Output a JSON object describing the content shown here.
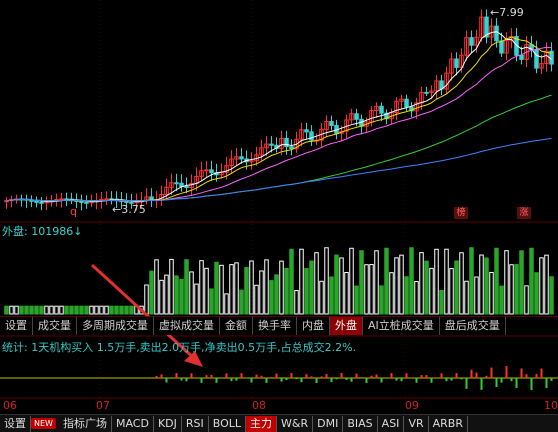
{
  "price_chart": {
    "high_marker": "7.99",
    "low_marker": "3.75",
    "q_marker": "q",
    "badges": [
      "榜",
      "涨"
    ]
  },
  "volume": {
    "title": "外盘: 101986",
    "arrow": "↓"
  },
  "tabs": [
    {
      "label": "设置",
      "active": false
    },
    {
      "label": "成交量",
      "active": false
    },
    {
      "label": "多周期成交量",
      "active": false
    },
    {
      "label": "虚拟成交量",
      "active": false
    },
    {
      "label": "金额",
      "active": false
    },
    {
      "label": "换手率",
      "active": false
    },
    {
      "label": "内盘",
      "active": false
    },
    {
      "label": "外盘",
      "active": true
    },
    {
      "label": "AI立桩成交量",
      "active": false
    },
    {
      "label": "盘后成交量",
      "active": false
    }
  ],
  "stat_line": "统计: 1天机构买入 1.5万手,卖出2.0万手,净卖出0.5万手,占总成交2.2%.",
  "x_axis": [
    "06",
    "07",
    "08",
    "09",
    "10"
  ],
  "bottom_bar": [
    {
      "label": "设置",
      "active": false
    },
    {
      "label": "NEW",
      "badge": true
    },
    {
      "label": "指标广场",
      "active": false
    },
    {
      "label": "MACD",
      "active": false
    },
    {
      "label": "KDJ",
      "active": false
    },
    {
      "label": "RSI",
      "active": false
    },
    {
      "label": "BOLL",
      "active": false
    },
    {
      "label": "主力",
      "active": true
    },
    {
      "label": "W&R",
      "active": false
    },
    {
      "label": "DMI",
      "active": false
    },
    {
      "label": "BIAS",
      "active": false
    },
    {
      "label": "ASI",
      "active": false
    },
    {
      "label": "VR",
      "active": false
    },
    {
      "label": "ARBR",
      "active": false
    }
  ],
  "colors": {
    "up": "#ff3030",
    "down": "#36d3d3",
    "vol_up": "#ffffff",
    "vol_down": "#2aa52a",
    "annotation_arrow": "#e03030"
  }
}
